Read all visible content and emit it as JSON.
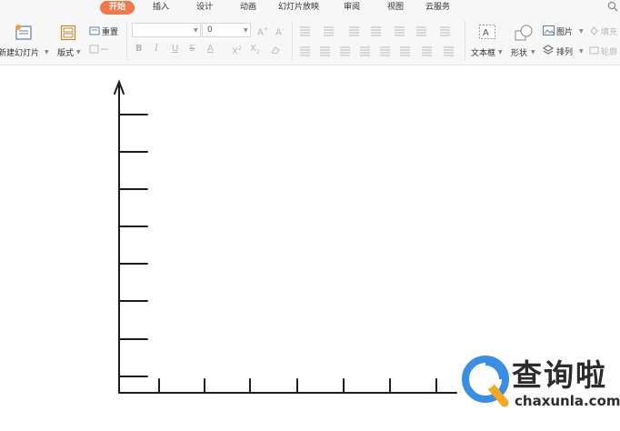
{
  "tabs": [
    {
      "label": "开始",
      "active": true
    },
    {
      "label": "插入",
      "active": false
    },
    {
      "label": "设计",
      "active": false
    },
    {
      "label": "动画",
      "active": false
    },
    {
      "label": "幻灯片放映",
      "active": false
    },
    {
      "label": "审阅",
      "active": false
    },
    {
      "label": "视图",
      "active": false
    },
    {
      "label": "云服务",
      "active": false
    }
  ],
  "ribbon": {
    "new_slide": "新建幻灯片",
    "layout": "版式",
    "reset": "重置",
    "font_size_value": "0",
    "text_box": "文本框",
    "shape": "形状",
    "picture": "图片",
    "arrange": "排列",
    "fill": "填充",
    "outline": "轮廓"
  },
  "colors": {
    "accent": "#f0784a",
    "ribbon_bg": "#f7f7f7",
    "watermark_blue": "#3a8ee6",
    "watermark_orange": "#f5a623",
    "axis": "#1e1e1e"
  },
  "icons": [
    "search-icon",
    "new-slide-icon",
    "layout-icon",
    "reset-icon",
    "section-icon",
    "text-box-icon",
    "shape-icon",
    "picture-icon",
    "arrange-icon",
    "fill-icon",
    "outline-icon"
  ],
  "watermark": {
    "title": "查询啦",
    "url": "chaxunla.com"
  }
}
